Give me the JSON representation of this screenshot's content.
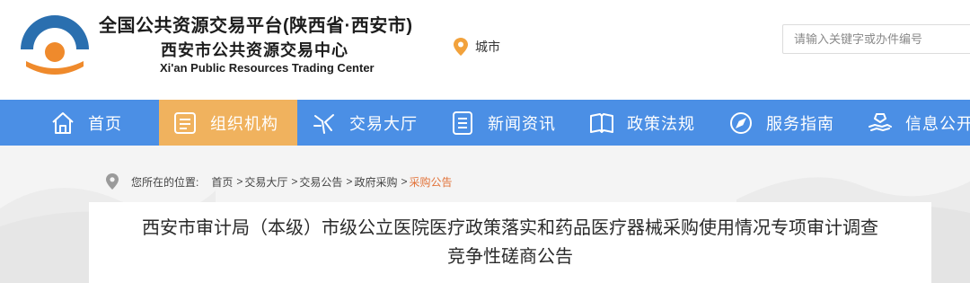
{
  "header": {
    "title_cn": "全国公共资源交易平台(陕西省·西安市)",
    "subtitle_cn": "西安市公共资源交易中心",
    "subtitle_en": "Xi'an Public Resources Trading Center",
    "city_label": "城市",
    "search_placeholder": "请输入关键字或办件编号"
  },
  "nav": {
    "items": [
      {
        "label": "首页",
        "icon": "home-icon",
        "active": false
      },
      {
        "label": "组织机构",
        "icon": "document-icon",
        "active": true
      },
      {
        "label": "交易大厅",
        "icon": "hall-icon",
        "active": false
      },
      {
        "label": "新闻资讯",
        "icon": "news-icon",
        "active": false
      },
      {
        "label": "政策法规",
        "icon": "book-icon",
        "active": false
      },
      {
        "label": "服务指南",
        "icon": "compass-icon",
        "active": false
      },
      {
        "label": "信息公开",
        "icon": "hand-icon",
        "active": false
      }
    ]
  },
  "breadcrumb": {
    "prefix": "您所在的位置:",
    "items": [
      "首页",
      "交易大厅",
      "交易公告",
      "政府采购",
      "采购公告"
    ],
    "separator": ">"
  },
  "article": {
    "title_line1": "西安市审计局（本级）市级公立医院医疗政策落实和药品医疗器械采购使用情况专项审计调查",
    "title_line2": "竞争性磋商公告"
  },
  "colors": {
    "nav_bg": "#4b8fe5",
    "nav_active": "#f0b25e",
    "logo_blue": "#2a6faf",
    "logo_orange": "#ef8a2c",
    "breadcrumb_current": "#e2733a"
  }
}
